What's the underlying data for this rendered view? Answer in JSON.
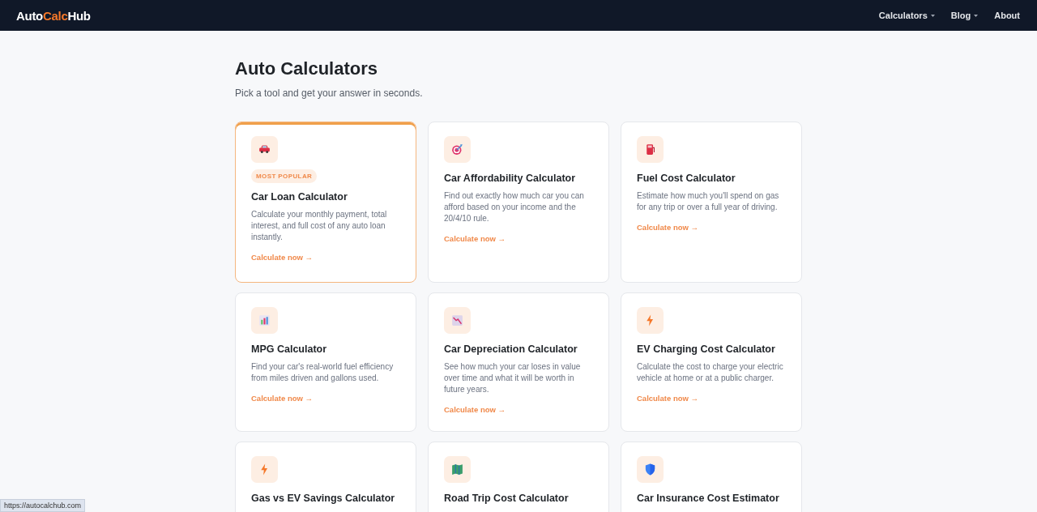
{
  "nav": {
    "logo": [
      {
        "text": "Auto",
        "accent": false
      },
      {
        "text": "Calc",
        "accent": true
      },
      {
        "text": "Hub",
        "accent": false
      }
    ],
    "links": [
      {
        "label": "Calculators",
        "dropdown": true
      },
      {
        "label": "Blog",
        "dropdown": true
      },
      {
        "label": "About",
        "dropdown": false
      }
    ]
  },
  "page": {
    "title": "Auto Calculators",
    "subtitle": "Pick a tool and get your answer in seconds."
  },
  "cards": [
    {
      "kind": "car",
      "featured": true,
      "badge": "MOST POPULAR",
      "title": "Car Loan Calculator",
      "description": "Calculate your monthly payment, total interest, and full cost of any auto loan instantly.",
      "link": "Calculate now →"
    },
    {
      "kind": "target",
      "featured": false,
      "title": "Car Affordability Calculator",
      "description": "Find out exactly how much car you can afford based on your income and the 20/4/10 rule.",
      "link": "Calculate now →"
    },
    {
      "kind": "fuel",
      "featured": false,
      "title": "Fuel Cost Calculator",
      "description": "Estimate how much you'll spend on gas for any trip or over a full year of driving.",
      "link": "Calculate now →"
    },
    {
      "kind": "chart",
      "featured": false,
      "title": "MPG Calculator",
      "description": "Find your car's real-world fuel efficiency from miles driven and gallons used.",
      "link": "Calculate now →"
    },
    {
      "kind": "decline",
      "featured": false,
      "title": "Car Depreciation Calculator",
      "description": "See how much your car loses in value over time and what it will be worth in future years.",
      "link": "Calculate now →"
    },
    {
      "kind": "bolt",
      "featured": false,
      "title": "EV Charging Cost Calculator",
      "description": "Calculate the cost to charge your electric vehicle at home or at a public charger.",
      "link": "Calculate now →"
    },
    {
      "kind": "bolt",
      "featured": false,
      "title": "Gas vs EV Savings Calculator"
    },
    {
      "kind": "map",
      "featured": false,
      "title": "Road Trip Cost Calculator"
    },
    {
      "kind": "shield",
      "featured": false,
      "title": "Car Insurance Cost Estimator"
    }
  ],
  "status_bar": {
    "url": "https://autocalchub.com"
  }
}
